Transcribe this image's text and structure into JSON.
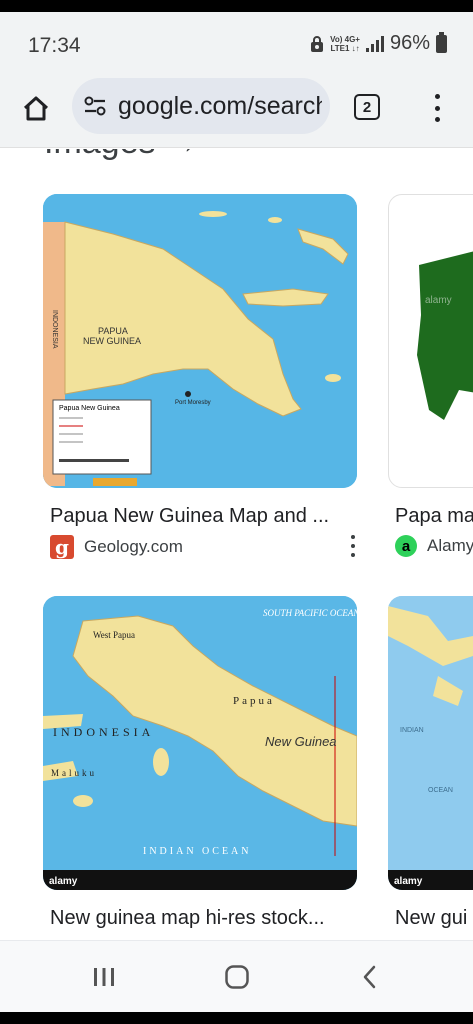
{
  "status_bar": {
    "time": "17:34",
    "network_top": "Vo) 4G+",
    "network_bottom": "LTE1 ↓↑",
    "battery": "96%"
  },
  "browser": {
    "url": "google.com/search",
    "tab_count": "2"
  },
  "section": {
    "title": "Images"
  },
  "cards": [
    {
      "title": "Papua New Guinea Map and ...",
      "source": "Geology.com",
      "favicon": "g",
      "map_labels": {
        "country": "PAPUA NEW GUINEA",
        "neighbor": "INDONESIA",
        "legend_title": "Papua New Guinea",
        "capital": "Port Moresby"
      }
    },
    {
      "title": "Papa ma",
      "source": "Alamy",
      "favicon": "a",
      "watermark": "alamy"
    },
    {
      "title": "New guinea map hi-res stock...",
      "source": "",
      "map_labels": {
        "ocean_top": "SOUTH PACIFIC OCEAN",
        "region_west": "West Papua",
        "region_papua": "Papua",
        "country": "INDONESIA",
        "island": "New Guinea",
        "islands_maluku": "Maluku",
        "ocean_bottom": "INDIAN OCEAN",
        "watermark": "alamy"
      }
    },
    {
      "title": "New gui",
      "source": "",
      "map_labels": {
        "label_a": "INDIAN",
        "label_b": "OCEAN",
        "watermark": "alamy"
      }
    }
  ],
  "colors": {
    "sea": "#4fb4e8",
    "land": "#f2e29b",
    "alamy_green": "#1e6b1e",
    "chrome_bg": "#f1f3f4"
  }
}
